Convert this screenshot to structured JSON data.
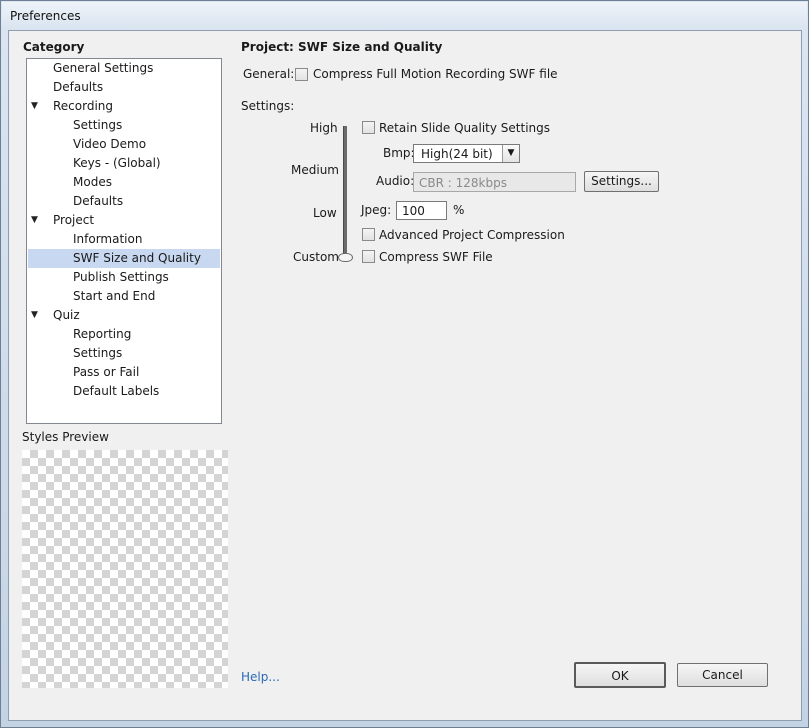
{
  "window": {
    "title": "Preferences"
  },
  "category": {
    "heading": "Category",
    "items": [
      {
        "label": "General Settings",
        "level": 0,
        "twisty": ""
      },
      {
        "label": "Defaults",
        "level": 0,
        "twisty": ""
      },
      {
        "label": "Recording",
        "level": 0,
        "twisty": "▼"
      },
      {
        "label": "Settings",
        "level": 1,
        "twisty": ""
      },
      {
        "label": "Video Demo",
        "level": 1,
        "twisty": ""
      },
      {
        "label": "Keys - (Global)",
        "level": 1,
        "twisty": ""
      },
      {
        "label": "Modes",
        "level": 1,
        "twisty": ""
      },
      {
        "label": "Defaults",
        "level": 1,
        "twisty": ""
      },
      {
        "label": "Project",
        "level": 0,
        "twisty": "▼"
      },
      {
        "label": "Information",
        "level": 1,
        "twisty": ""
      },
      {
        "label": "SWF Size and Quality",
        "level": 1,
        "twisty": "",
        "selected": true
      },
      {
        "label": "Publish Settings",
        "level": 1,
        "twisty": ""
      },
      {
        "label": "Start and End",
        "level": 1,
        "twisty": ""
      },
      {
        "label": "Quiz",
        "level": 0,
        "twisty": "▼"
      },
      {
        "label": "Reporting",
        "level": 1,
        "twisty": ""
      },
      {
        "label": "Settings",
        "level": 1,
        "twisty": ""
      },
      {
        "label": "Pass or Fail",
        "level": 1,
        "twisty": ""
      },
      {
        "label": "Default Labels",
        "level": 1,
        "twisty": ""
      }
    ]
  },
  "styles_preview": {
    "label": "Styles Preview"
  },
  "panel": {
    "title": "Project: SWF Size and Quality",
    "general_label": "General:",
    "compress_full_motion": {
      "label": "Compress Full Motion Recording SWF file",
      "checked": false
    },
    "settings_label": "Settings:",
    "quality_levels": {
      "high": "High",
      "medium": "Medium",
      "low": "Low",
      "custom": "Custom"
    },
    "quality_selected": "Custom",
    "retain_slide_quality": {
      "label": "Retain Slide Quality Settings",
      "checked": false
    },
    "bmp": {
      "label": "Bmp:",
      "value": "High(24 bit)"
    },
    "audio": {
      "label": "Audio:",
      "value": "CBR : 128kbps",
      "settings_button": "Settings..."
    },
    "jpeg": {
      "label": "Jpeg:",
      "value": "100",
      "unit": "%"
    },
    "advanced_compression": {
      "label": "Advanced Project Compression",
      "checked": false
    },
    "compress_swf": {
      "label": "Compress SWF File",
      "checked": false
    }
  },
  "footer": {
    "help_link": "Help...",
    "ok_button": "OK",
    "cancel_button": "Cancel"
  }
}
